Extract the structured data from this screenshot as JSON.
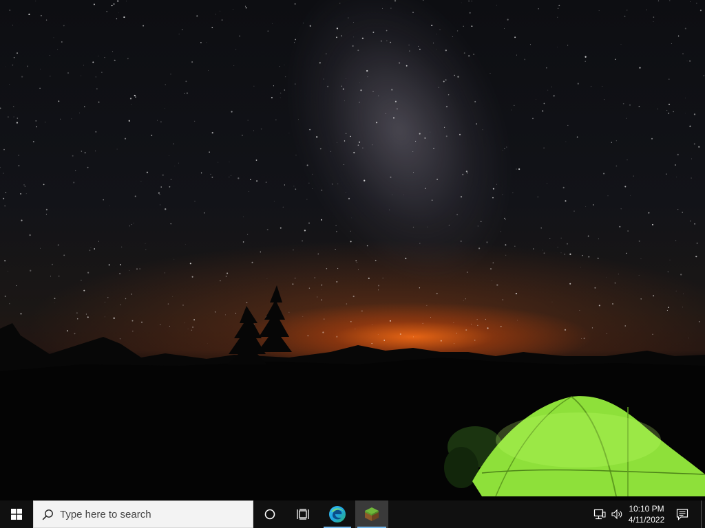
{
  "desktop": {
    "wallpaper": "night-sky-camping-tent",
    "colors": {
      "sky": "#121318",
      "horizon_glow": "#ff6e14",
      "mountains": "#060606",
      "tent": "#8ee03a"
    }
  },
  "taskbar": {
    "background": "#101010",
    "start_icon": "windows-logo-icon",
    "search": {
      "placeholder": "Type here to search",
      "icon": "search-icon"
    },
    "buttons": [
      {
        "name": "cortana",
        "icon": "circle-icon"
      },
      {
        "name": "task-view",
        "icon": "task-view-icon"
      },
      {
        "name": "edge",
        "icon": "edge-icon",
        "running": true
      },
      {
        "name": "minecraft",
        "icon": "minecraft-grass-block-icon",
        "running": true,
        "active": true
      }
    ],
    "tray": {
      "network_icon": "ethernet-icon",
      "volume_icon": "speaker-icon",
      "time": "10:10 PM",
      "date": "4/11/2022",
      "notification_icon": "action-center-icon"
    }
  }
}
